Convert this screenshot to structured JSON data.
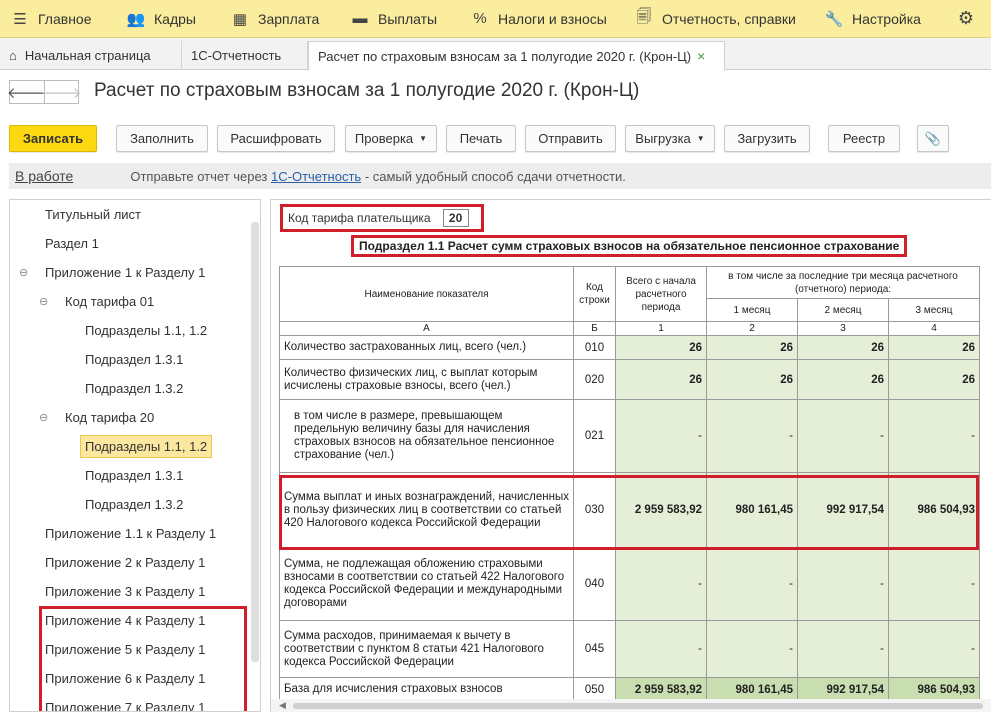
{
  "topbar": {
    "items": [
      {
        "label": "Главное",
        "icon": "menu-icon"
      },
      {
        "label": "Кадры",
        "icon": "people-icon"
      },
      {
        "label": "Зарплата",
        "icon": "calculator-icon"
      },
      {
        "label": "Выплаты",
        "icon": "wallet-icon"
      },
      {
        "label": "Налоги и взносы",
        "icon": "percent-icon"
      },
      {
        "label": "Отчетность, справки",
        "icon": "reports-icon"
      },
      {
        "label": "Настройка",
        "icon": "wrench-icon"
      }
    ],
    "settings_icon": "gear-icon"
  },
  "tabs": {
    "home": "Начальная страница",
    "t1": "1С-Отчетность",
    "t2": "Расчет по страховым взносам за 1 полугодие 2020 г. (Крон-Ц)",
    "close": "×"
  },
  "nav": {
    "back": "🡐",
    "forward": "🡒"
  },
  "title": "Расчет по страховым взносам за 1 полугодие 2020 г. (Крон-Ц)",
  "toolbar": {
    "save": "Записать",
    "fill": "Заполнить",
    "decode": "Расшифровать",
    "check": "Проверка",
    "print": "Печать",
    "send": "Отправить",
    "export": "Выгрузка",
    "load": "Загрузить",
    "registry": "Реестр",
    "attach_icon": "paperclip-icon"
  },
  "status": {
    "state": "В работе",
    "note_before": "Отправьте отчет через ",
    "note_link": "1С-Отчетность",
    "note_after": " - самый удобный способ сдачи отчетности."
  },
  "tree": [
    {
      "label": "Титульный лист"
    },
    {
      "label": "Раздел 1"
    },
    {
      "label": "Приложение 1 к Разделу 1",
      "toggle": "⊖"
    },
    {
      "label": "Код тарифа 01",
      "toggle": "⊖"
    },
    {
      "label": "Подразделы 1.1, 1.2"
    },
    {
      "label": "Подраздел 1.3.1"
    },
    {
      "label": "Подраздел 1.3.2"
    },
    {
      "label": "Код тарифа 20",
      "toggle": "⊖"
    },
    {
      "label": "Подразделы 1.1, 1.2",
      "selected": true
    },
    {
      "label": "Подраздел 1.3.1"
    },
    {
      "label": "Подраздел 1.3.2"
    },
    {
      "label": "Приложение 1.1 к Разделу 1"
    },
    {
      "label": "Приложение 2 к Разделу 1"
    },
    {
      "label": "Приложение 3 к Разделу 1"
    },
    {
      "label": "Приложение 4 к Разделу 1"
    },
    {
      "label": "Приложение 5 к Разделу 1"
    },
    {
      "label": "Приложение 6 к Разделу 1"
    },
    {
      "label": "Приложение 7 к Разделу 1"
    }
  ],
  "form": {
    "tariff_label": "Код тарифа плательщика",
    "tariff_value": "20",
    "subsection_title": "Подраздел 1.1 Расчет сумм страховых взносов на обязательное пенсионное страхование",
    "headers": {
      "name": "Наименование показателя",
      "code": "Код строки",
      "total": "Всего с начала расчетного периода",
      "last3": "в том числе за последние три месяца расчетного (отчетного) периода:",
      "m1": "1 месяц",
      "m2": "2 месяц",
      "m3": "3 месяц",
      "colA": "А",
      "colB": "Б",
      "c1": "1",
      "c2": "2",
      "c3": "3",
      "c4": "4"
    },
    "rows": [
      {
        "name": "Количество застрахованных лиц, всего (чел.)",
        "code": "010",
        "v": [
          "26",
          "26",
          "26",
          "26"
        ]
      },
      {
        "name": "Количество физических лиц, с выплат которым исчислены страховые взносы, всего (чел.)",
        "code": "020",
        "v": [
          "26",
          "26",
          "26",
          "26"
        ]
      },
      {
        "name": "в том числе в размере, превышающем предельную величину базы для начисления страховых взносов на обязательное пенсионное страхование (чел.)",
        "code": "021",
        "v": [
          "-",
          "-",
          "-",
          "-"
        ]
      },
      {
        "name": "Сумма выплат и иных вознаграждений, начисленных в пользу физических лиц в соответствии со статьей 420 Налогового кодекса Российской Федерации",
        "code": "030",
        "v": [
          "2 959 583,92",
          "980 161,45",
          "992 917,54",
          "986 504,93"
        ]
      },
      {
        "name": "Сумма, не подлежащая обложению страховыми взносами в соответствии со статьей 422 Налогового кодекса Российской Федерации и международными договорами",
        "code": "040",
        "v": [
          "-",
          "-",
          "-",
          "-"
        ]
      },
      {
        "name": "Сумма расходов, принимаемая к вычету в соответствии с пунктом 8 статьи 421 Налогового кодекса Российской Федерации",
        "code": "045",
        "v": [
          "-",
          "-",
          "-",
          "-"
        ]
      },
      {
        "name": "База для исчисления страховых взносов",
        "code": "050",
        "v": [
          "2 959 583,92",
          "980 161,45",
          "992 917,54",
          "986 504,93"
        ]
      }
    ]
  },
  "colors": {
    "topbar": "#fbed9e",
    "primary_button": "#fcd811",
    "highlight_red": "#d01f2a",
    "cell_green": "#e5efd8"
  }
}
